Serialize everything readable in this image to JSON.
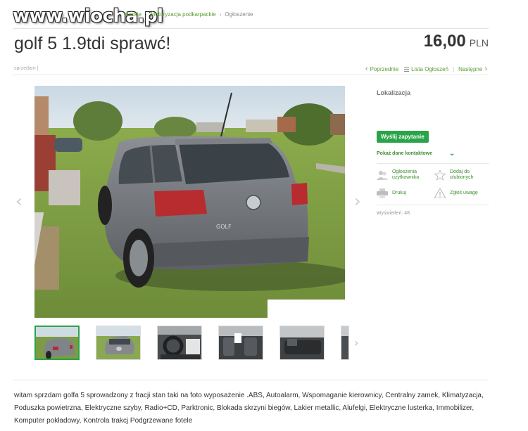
{
  "watermark": "www.wiocha.pl",
  "breadcrumb": [
    "packie",
    "Motoryzacja podkarpackie",
    "Ogłoszenie"
  ],
  "ad": {
    "title": "golf 5 1.9tdi sprawć!",
    "price": "16,00",
    "currency": "PLN"
  },
  "meta": {
    "left": "sprzedam |",
    "prev": "Poprzednie",
    "list": "Lista Ogłoszeń",
    "next": "Następne"
  },
  "sidebar": {
    "location_label": "Lokalizacja",
    "send_button": "Wyślij zapytanie",
    "show_contact": "Pokaż dane kontaktowe",
    "actions": {
      "user_ads": "Ogłoszenia użytkownika",
      "add_fav": "Dodaj do ulubionych",
      "print": "Drukuj",
      "report": "Zgłoś uwagę"
    },
    "views": "Wyświetleń: 48"
  },
  "description": "witam sprzdam golfa 5 sprowadzony z fracji stan taki na foto wyposażenie .ABS, Autoalarm, Wspomaganie kierownicy, Centralny zamek, Klimatyzacja, Poduszka powietrzna, Elektryczne szyby, Radio+CD, Parktronic, Blokada skrzyni biegów, Lakier metallic, Alufelgi, Elektryczne lusterka, Immobilizer, Komputer pokładowy, Kontrola trakcj Podgrzewane fotele",
  "car_badge": "GOLF",
  "icons": {
    "prev_arrow": "chevron-left-icon",
    "next_arrow": "chevron-right-icon",
    "list": "list-icon",
    "users": "users-icon",
    "star": "star-icon",
    "print": "printer-icon",
    "warning": "warning-icon"
  },
  "colors": {
    "accent": "#2aa34a",
    "link": "#5a9e2f"
  }
}
